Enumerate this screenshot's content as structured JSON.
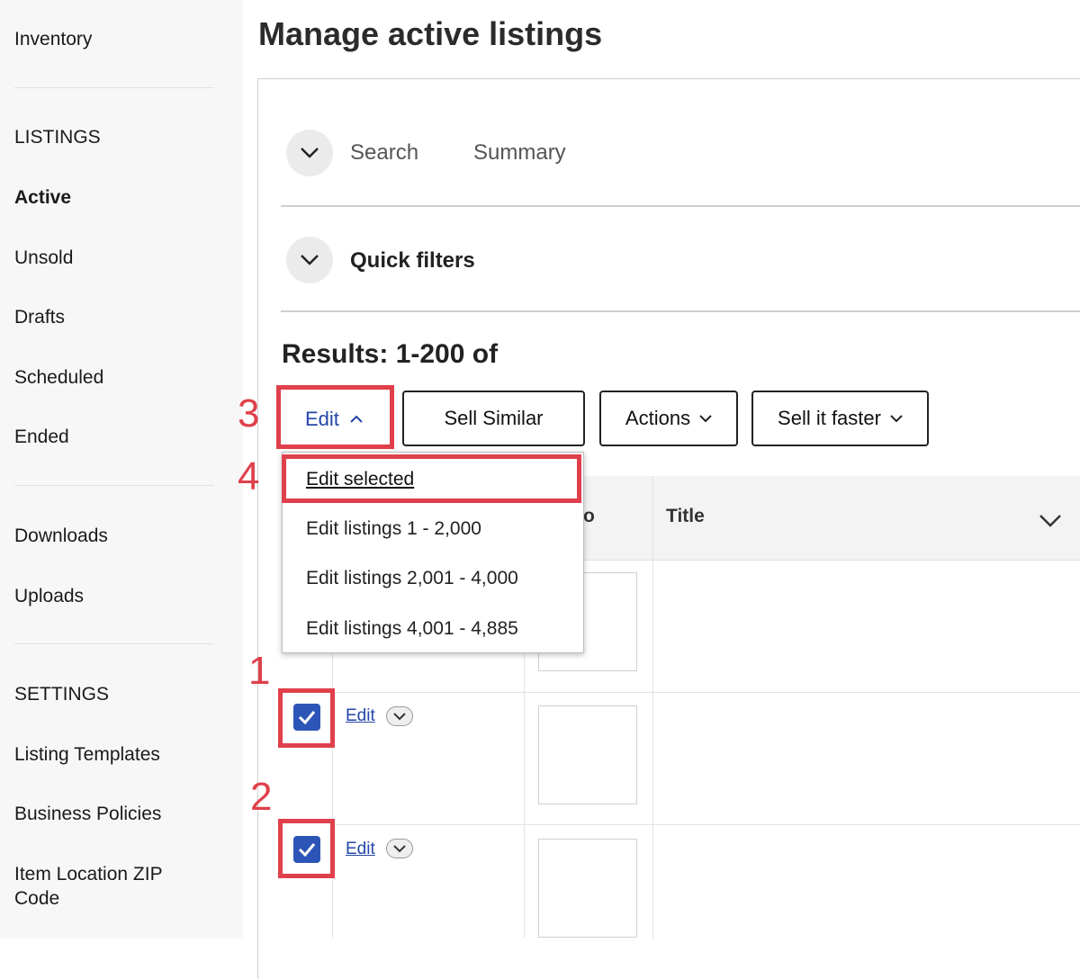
{
  "sidebar": {
    "inventory": "Inventory",
    "listings_heading": "LISTINGS",
    "items": [
      "Active",
      "Unsold",
      "Drafts",
      "Scheduled",
      "Ended"
    ],
    "downloads": "Downloads",
    "uploads": "Uploads",
    "settings_heading": "SETTINGS",
    "settings_items": [
      "Listing Templates",
      "Business Policies",
      "Item Location ZIP Code"
    ]
  },
  "page": {
    "title": "Manage active listings"
  },
  "tabs": {
    "search": "Search",
    "summary": "Summary"
  },
  "quick_filters": "Quick filters",
  "results": "Results: 1-200 of",
  "toolbar": {
    "edit": "Edit",
    "sell_similar": "Sell Similar",
    "actions": "Actions",
    "sell_faster": "Sell it faster"
  },
  "edit_menu": {
    "items": [
      "Edit selected",
      "Edit listings 1 - 2,000",
      "Edit listings 2,001 - 4,000",
      "Edit listings 4,001 - 4,885"
    ]
  },
  "table": {
    "title_header": "Title",
    "photo_header_partial": "o"
  },
  "rows": [
    {
      "edit": "Edit"
    },
    {
      "edit": "Edit"
    }
  ],
  "annotations": [
    "1",
    "2",
    "3",
    "4"
  ],
  "colors": {
    "annotation_red": "#e0404b",
    "link_blue": "#2445a8",
    "checkbox_blue": "#2d55b7"
  }
}
